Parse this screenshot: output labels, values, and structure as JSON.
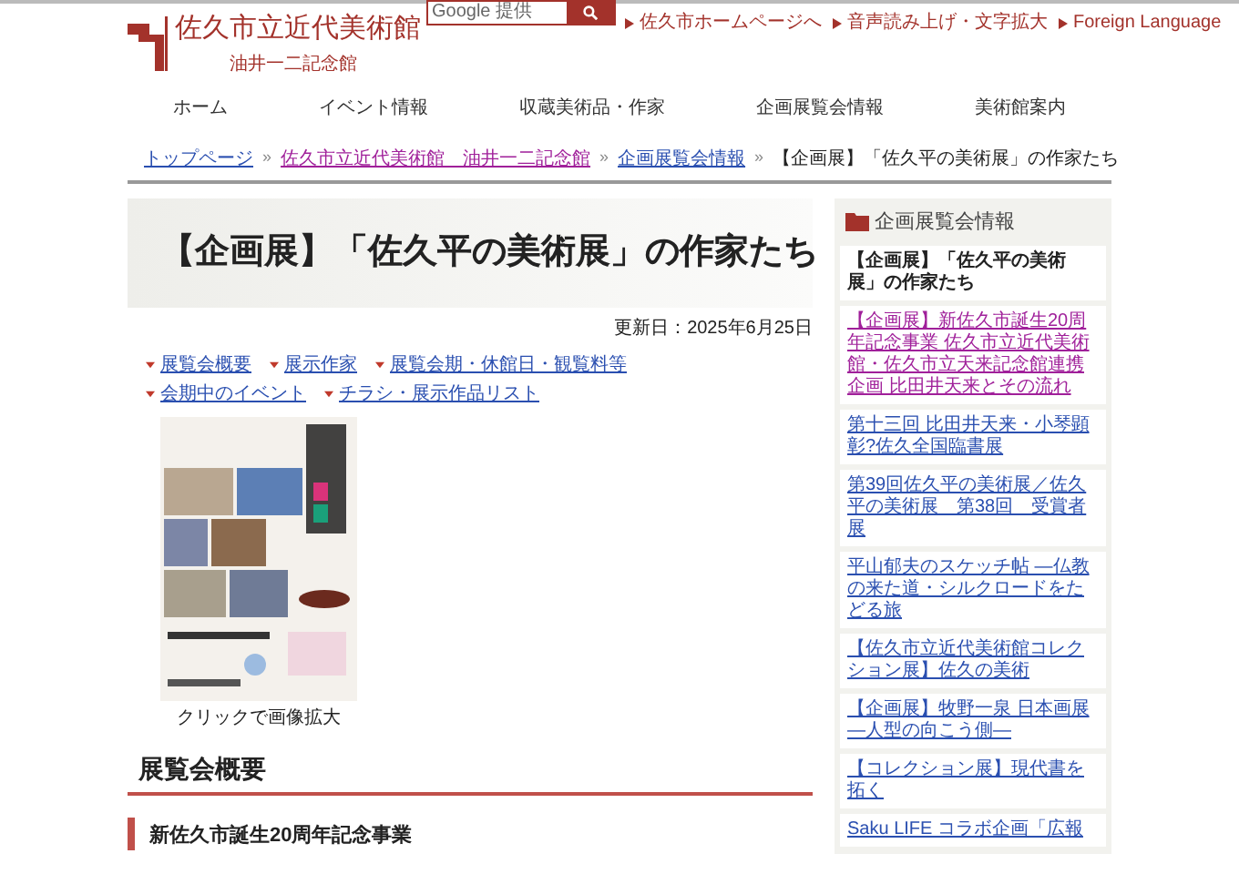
{
  "header": {
    "site_title": "佐久市立近代美術館",
    "site_subtitle": "油井一二記念館",
    "search": {
      "placeholder": "Google 提供"
    },
    "top_links": [
      "佐久市ホームページへ",
      "音声読み上げ・文字拡大",
      "Foreign Language"
    ]
  },
  "nav": [
    "ホーム",
    "イベント情報",
    "収蔵美術品・作家",
    "企画展覧会情報",
    "美術館案内"
  ],
  "breadcrumb": [
    {
      "label": "トップページ",
      "kind": "link",
      "visited": false
    },
    {
      "label": "佐久市立近代美術館　油井一二記念館",
      "kind": "link",
      "visited": true
    },
    {
      "label": "企画展覧会情報",
      "kind": "link",
      "visited": false
    },
    {
      "label": "【企画展】「佐久平の美術展」の作家たち",
      "kind": "current"
    }
  ],
  "breadcrumb_separator": "»",
  "page_title": "【企画展】「佐久平の美術展」の作家たち",
  "updated": "更新日：2025年6月25日",
  "anchor_links": [
    "展覧会概要",
    "展示作家",
    "展覧会期・休館日・観覧料等",
    "会期中のイベント",
    "チラシ・展示作品リスト"
  ],
  "poster": {
    "caption": "クリックで画像拡大"
  },
  "section_heading": "展覧会概要",
  "section_box": [
    "新佐久市誕生20周年記念事業"
  ],
  "sidebar": {
    "heading": "企画展覧会情報",
    "items": [
      {
        "label": "【企画展】「佐久平の美術展」の作家たち",
        "selected": true
      },
      {
        "label": "【企画展】新佐久市誕生20周年記念事業 佐久市立近代美術館・佐久市立天来記念館連携企画 比田井天来とその流れ",
        "selected": false,
        "visited": true
      },
      {
        "label": "第十三回 比田井天来・小琴顕彰?佐久全国臨書展",
        "selected": false,
        "visited": false
      },
      {
        "label": "第39回佐久平の美術展／佐久平の美術展　第38回　受賞者展",
        "selected": false,
        "visited": false
      },
      {
        "label": "平山郁夫のスケッチ帖 ―仏教の来た道・シルクロードをたどる旅",
        "selected": false,
        "visited": false
      },
      {
        "label": "【佐久市立近代美術館コレクション展】佐久の美術",
        "selected": false,
        "visited": false
      },
      {
        "label": "【企画展】牧野一泉 日本画展 ―人型の向こう側―",
        "selected": false,
        "visited": false
      },
      {
        "label": "【コレクション展】現代書を拓く",
        "selected": false,
        "visited": false
      },
      {
        "label": "Saku LIFE コラボ企画「広報",
        "selected": false,
        "visited": false
      }
    ]
  }
}
